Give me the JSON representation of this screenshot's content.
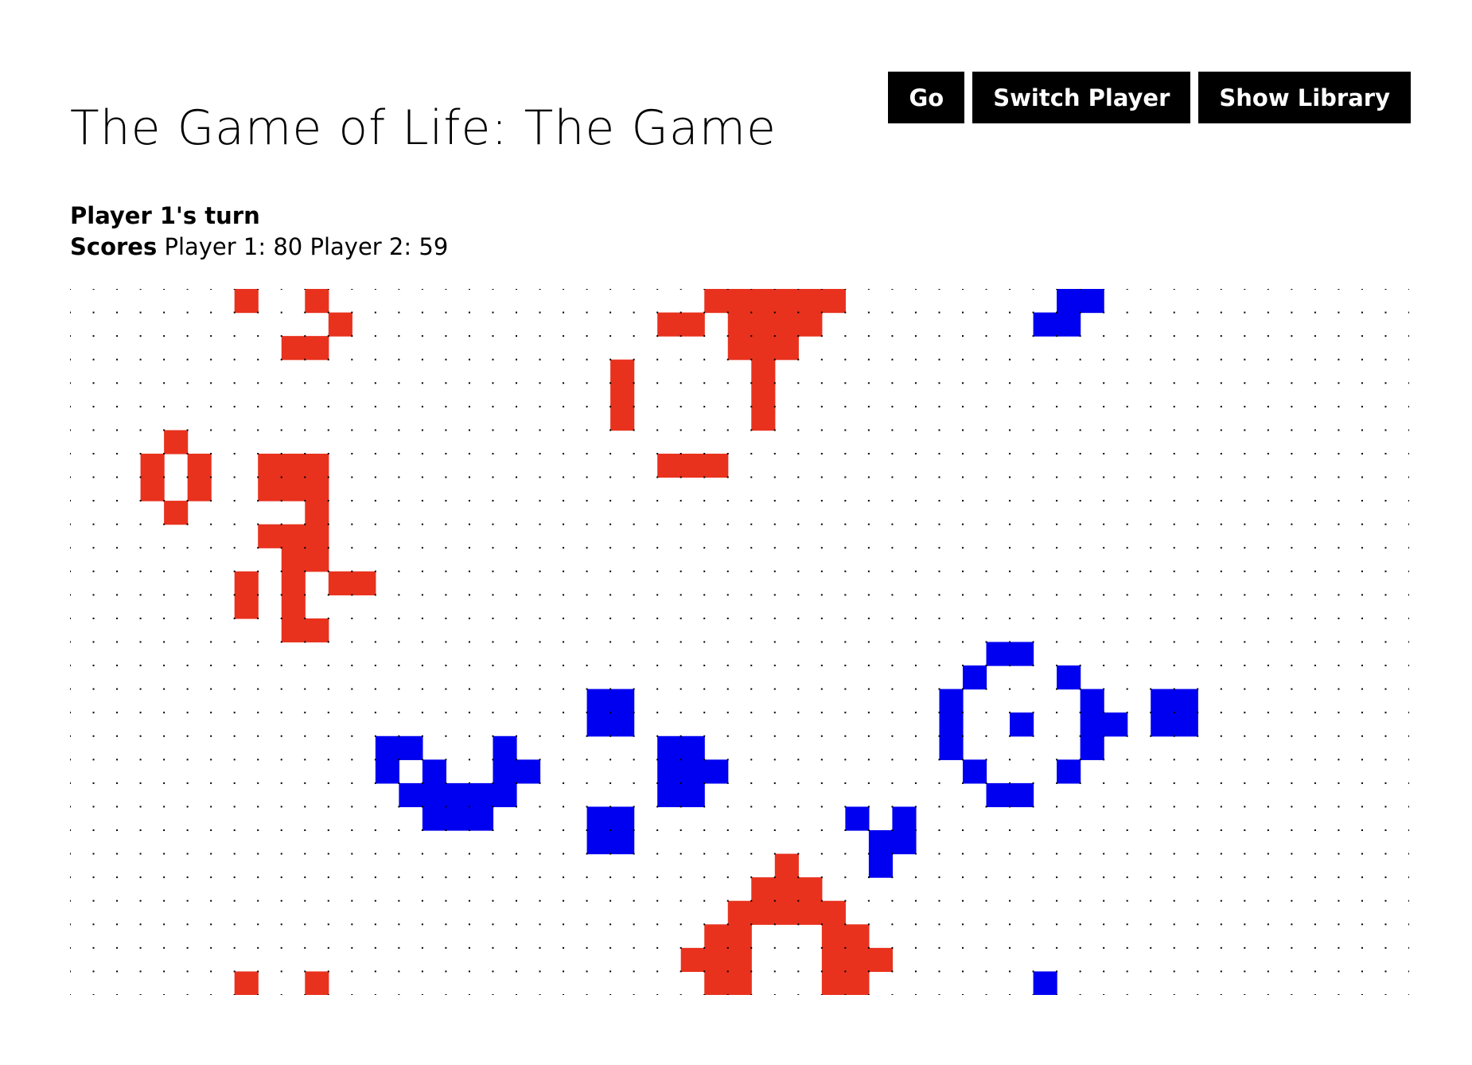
{
  "title": "The Game of Life: The Game",
  "toolbar": {
    "go_label": "Go",
    "switch_player_label": "Switch Player",
    "show_library_label": "Show Library"
  },
  "status": {
    "turn_text": "Player 1's turn",
    "scores_label": "Scores",
    "scores_text": "Player 1: 80 Player 2: 59"
  },
  "colors": {
    "player1": "#e8321e",
    "player2": "#0000f0",
    "grid_dot": "#000000",
    "button_bg": "#000000",
    "button_text": "#ffffff"
  },
  "board": {
    "columns": 57,
    "rows": 30,
    "player1_cells": [
      [
        7,
        0
      ],
      [
        10,
        0
      ],
      [
        11,
        1
      ],
      [
        9,
        2
      ],
      [
        10,
        2
      ],
      [
        25,
        1
      ],
      [
        26,
        1
      ],
      [
        27,
        0
      ],
      [
        28,
        0
      ],
      [
        29,
        0
      ],
      [
        30,
        0
      ],
      [
        31,
        0
      ],
      [
        32,
        0
      ],
      [
        28,
        1
      ],
      [
        29,
        1
      ],
      [
        30,
        1
      ],
      [
        31,
        1
      ],
      [
        28,
        2
      ],
      [
        29,
        2
      ],
      [
        30,
        2
      ],
      [
        29,
        3
      ],
      [
        29,
        4
      ],
      [
        29,
        5
      ],
      [
        23,
        3
      ],
      [
        23,
        4
      ],
      [
        23,
        5
      ],
      [
        25,
        7
      ],
      [
        26,
        7
      ],
      [
        27,
        7
      ],
      [
        4,
        6
      ],
      [
        3,
        7
      ],
      [
        5,
        7
      ],
      [
        3,
        8
      ],
      [
        5,
        8
      ],
      [
        4,
        9
      ],
      [
        8,
        7
      ],
      [
        9,
        7
      ],
      [
        10,
        7
      ],
      [
        8,
        8
      ],
      [
        9,
        8
      ],
      [
        10,
        8
      ],
      [
        10,
        9
      ],
      [
        8,
        10
      ],
      [
        9,
        10
      ],
      [
        10,
        10
      ],
      [
        9,
        11
      ],
      [
        10,
        11
      ],
      [
        11,
        12
      ],
      [
        12,
        12
      ],
      [
        7,
        12
      ],
      [
        7,
        13
      ],
      [
        9,
        12
      ],
      [
        9,
        13
      ],
      [
        9,
        14
      ],
      [
        10,
        14
      ],
      [
        30,
        24
      ],
      [
        29,
        25
      ],
      [
        30,
        25
      ],
      [
        31,
        25
      ],
      [
        28,
        26
      ],
      [
        29,
        26
      ],
      [
        30,
        26
      ],
      [
        31,
        26
      ],
      [
        32,
        26
      ],
      [
        27,
        27
      ],
      [
        28,
        27
      ],
      [
        32,
        27
      ],
      [
        33,
        27
      ],
      [
        26,
        28
      ],
      [
        27,
        28
      ],
      [
        28,
        28
      ],
      [
        32,
        28
      ],
      [
        33,
        28
      ],
      [
        34,
        28
      ],
      [
        27,
        29
      ],
      [
        28,
        29
      ],
      [
        32,
        29
      ],
      [
        33,
        29
      ],
      [
        7,
        29
      ],
      [
        10,
        29
      ]
    ],
    "player2_cells": [
      [
        42,
        0
      ],
      [
        43,
        0
      ],
      [
        41,
        1
      ],
      [
        42,
        1
      ],
      [
        39,
        15
      ],
      [
        40,
        15
      ],
      [
        38,
        16
      ],
      [
        42,
        16
      ],
      [
        37,
        17
      ],
      [
        43,
        17
      ],
      [
        37,
        18
      ],
      [
        40,
        18
      ],
      [
        43,
        18
      ],
      [
        44,
        18
      ],
      [
        37,
        19
      ],
      [
        43,
        19
      ],
      [
        38,
        20
      ],
      [
        42,
        20
      ],
      [
        39,
        21
      ],
      [
        40,
        21
      ],
      [
        46,
        17
      ],
      [
        47,
        17
      ],
      [
        46,
        18
      ],
      [
        47,
        18
      ],
      [
        22,
        17
      ],
      [
        23,
        17
      ],
      [
        22,
        18
      ],
      [
        23,
        18
      ],
      [
        22,
        22
      ],
      [
        23,
        22
      ],
      [
        22,
        23
      ],
      [
        23,
        23
      ],
      [
        25,
        19
      ],
      [
        26,
        19
      ],
      [
        25,
        20
      ],
      [
        26,
        20
      ],
      [
        27,
        20
      ],
      [
        25,
        21
      ],
      [
        26,
        21
      ],
      [
        13,
        19
      ],
      [
        14,
        19
      ],
      [
        18,
        19
      ],
      [
        13,
        20
      ],
      [
        15,
        20
      ],
      [
        18,
        20
      ],
      [
        19,
        20
      ],
      [
        14,
        21
      ],
      [
        15,
        21
      ],
      [
        16,
        21
      ],
      [
        17,
        21
      ],
      [
        18,
        21
      ],
      [
        15,
        22
      ],
      [
        16,
        22
      ],
      [
        17,
        22
      ],
      [
        33,
        22
      ],
      [
        35,
        22
      ],
      [
        34,
        23
      ],
      [
        35,
        23
      ],
      [
        34,
        24
      ],
      [
        41,
        29
      ]
    ]
  }
}
